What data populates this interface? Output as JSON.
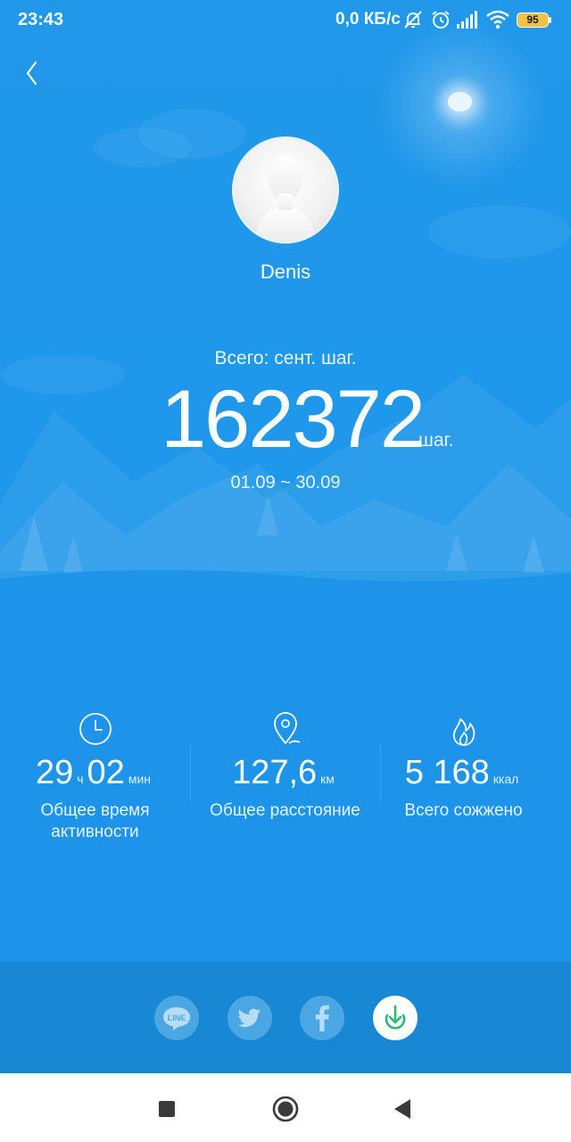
{
  "status_bar": {
    "time": "23:43",
    "network_speed": "0,0 КБ/с",
    "battery_level": "95",
    "icons": [
      "muted-bell-icon",
      "alarm-icon",
      "signal-icon",
      "wifi-icon",
      "battery-icon"
    ]
  },
  "header": {
    "back_icon": "chevron-left-icon"
  },
  "profile": {
    "name": "Denis",
    "avatar_icon": "default-user-avatar"
  },
  "summary": {
    "label": "Всего: сент. шаг.",
    "steps": "162372",
    "steps_unit": "шаг.",
    "date_range": "01.09 ~ 30.09"
  },
  "stats": [
    {
      "icon": "clock-icon",
      "hours": "29",
      "hours_unit": "ч",
      "minutes": "02",
      "minutes_unit": "мин",
      "label_line1": "Общее время",
      "label_line2": "активности"
    },
    {
      "icon": "location-pin-icon",
      "value": "127,6",
      "unit": "км",
      "label_line1": "Общее расстояние"
    },
    {
      "icon": "flame-icon",
      "value": "5 168",
      "unit": "ккал",
      "label_line1": "Всего сожжено"
    }
  ],
  "share": {
    "buttons": [
      {
        "name": "line",
        "icon": "line-icon",
        "text": "LINE"
      },
      {
        "name": "twitter",
        "icon": "twitter-icon"
      },
      {
        "name": "facebook",
        "icon": "facebook-icon"
      },
      {
        "name": "download",
        "icon": "download-icon"
      }
    ]
  },
  "nav_bar": {
    "icons": [
      "recents-square-icon",
      "home-circle-icon",
      "back-triangle-icon"
    ]
  },
  "colors": {
    "background": "#1d97ea",
    "share_bar": "#1888d4",
    "download_accent": "#2eb872"
  }
}
